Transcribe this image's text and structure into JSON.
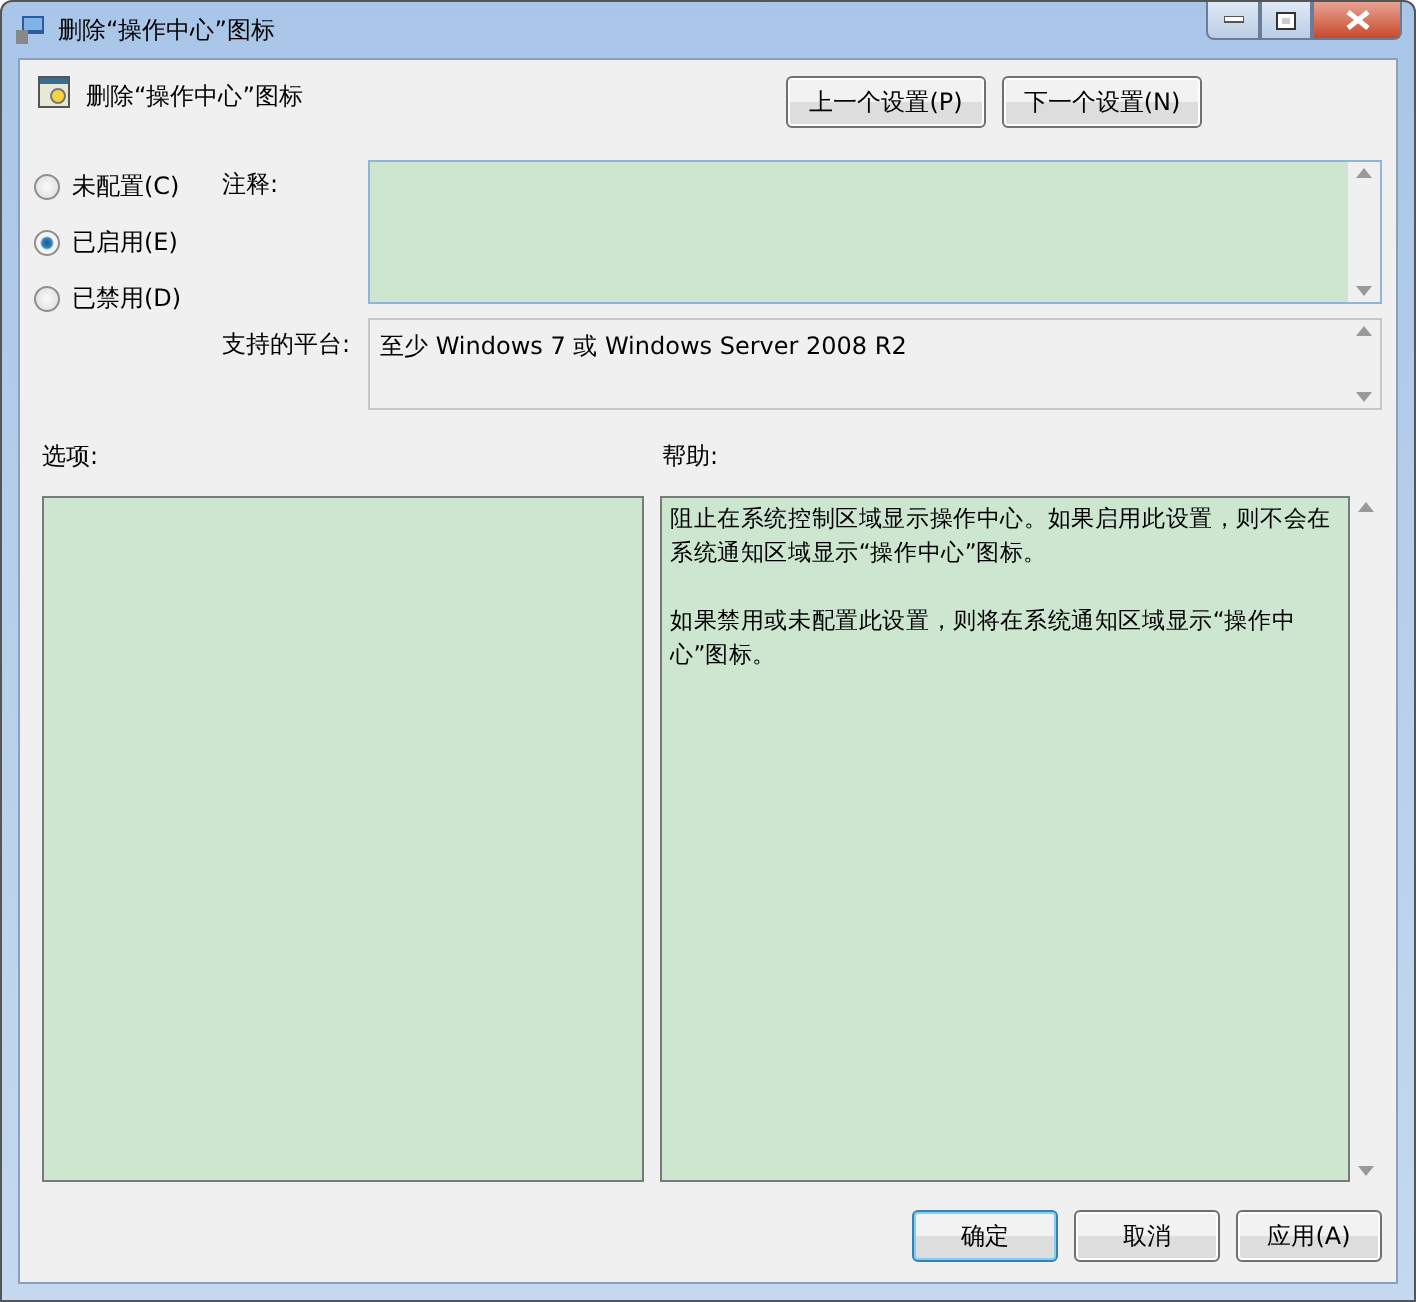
{
  "window": {
    "title": "删除“操作中心”图标"
  },
  "policy_title": "删除“操作中心”图标",
  "nav_buttons": [
    "上一个设置(P)",
    "下一个设置(N)"
  ],
  "states": [
    {
      "label": "未配置(C)",
      "selected": false
    },
    {
      "label": "已启用(E)",
      "selected": true
    },
    {
      "label": "已禁用(D)",
      "selected": false
    }
  ],
  "comment": {
    "label": "注释:"
  },
  "platform": {
    "label": "支持的平台:",
    "value": "至少 Windows 7 或 Windows Server 2008 R2"
  },
  "options": {
    "label": "选项:"
  },
  "help": {
    "label": "帮助:",
    "paragraphs": [
      "阻止在系统控制区域显示操作中心。如果启用此设置，则不会在系统通知区域显示“操作中心”图标。",
      "如果禁用或未配置此设置，则将在系统通知区域显示“操作中心”图标。"
    ]
  },
  "buttons": [
    {
      "label": "确定",
      "default": true
    },
    {
      "label": "取消",
      "default": false
    },
    {
      "label": "应用(A)",
      "default": false
    }
  ]
}
